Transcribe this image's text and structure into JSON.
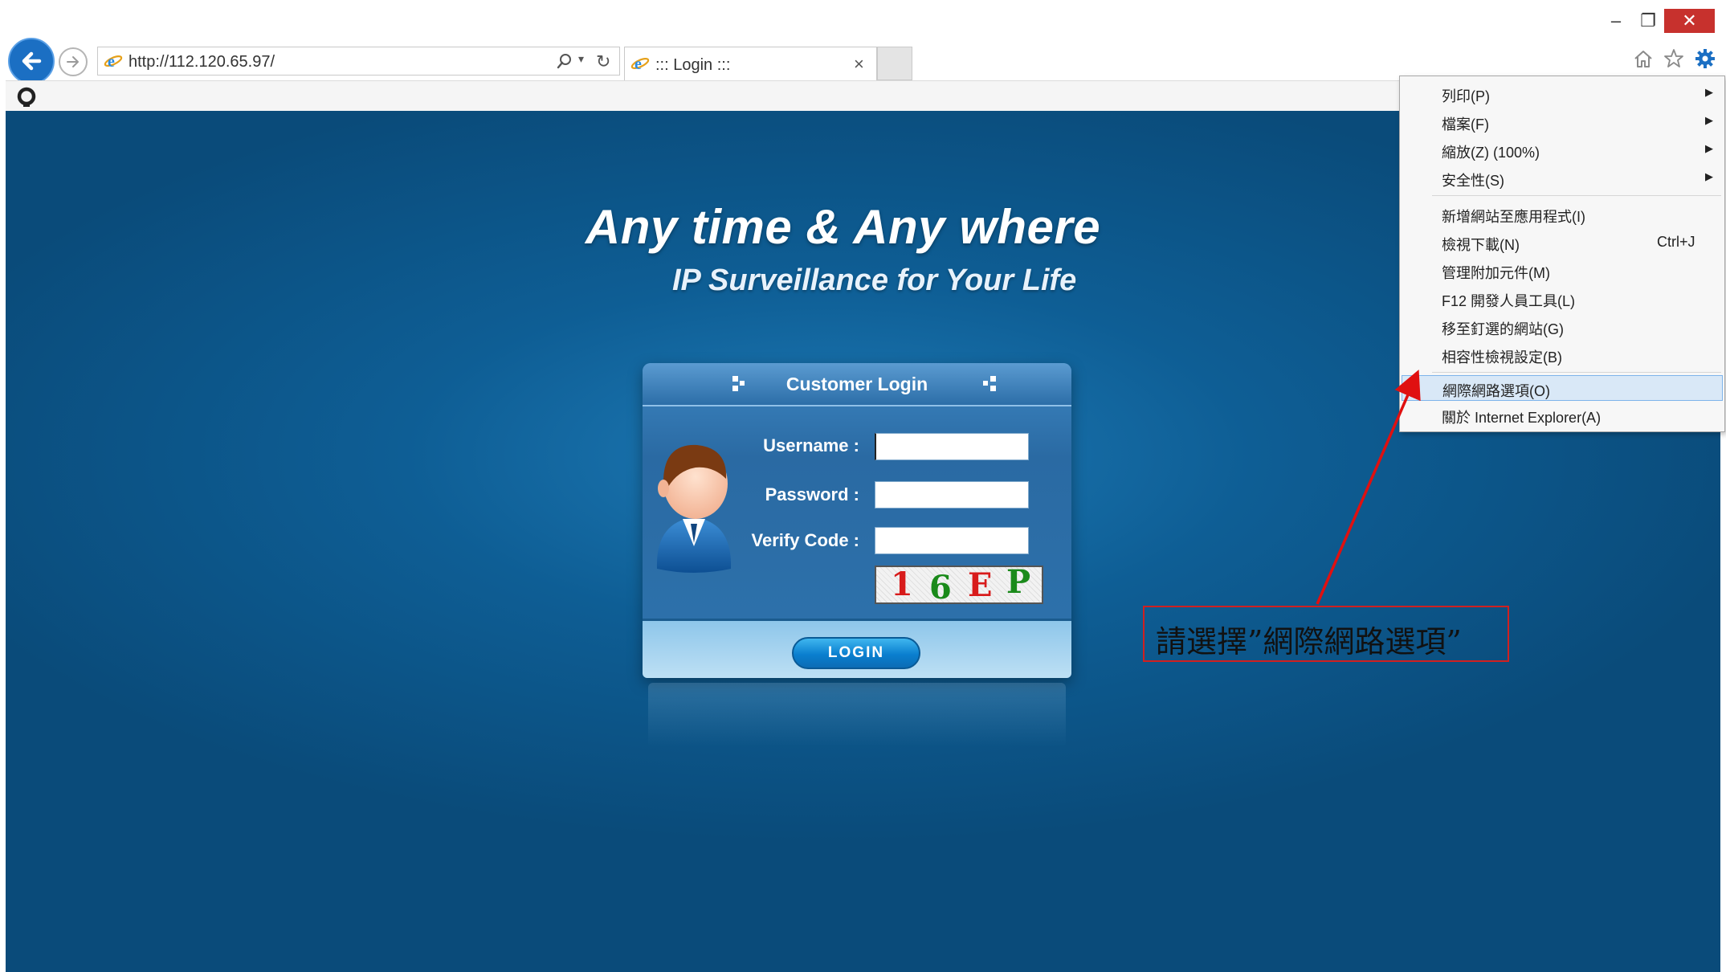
{
  "window": {
    "minimize_glyph": "–",
    "restore_glyph": "❐",
    "close_glyph": "✕"
  },
  "address_bar": {
    "url": "http://112.120.65.97/",
    "search_glyph": "⌕",
    "dropdown_glyph": "▾",
    "refresh_glyph": "↻"
  },
  "tab": {
    "title": "::: Login :::",
    "close_glyph": "×"
  },
  "page": {
    "headline": "Any time & Any where",
    "subheadline": "IP Surveillance for Your Life",
    "login": {
      "title": "Customer Login",
      "username_label": "Username :",
      "password_label": "Password :",
      "verify_label": "Verify Code :",
      "username_value": "",
      "password_value": "",
      "verify_value": "",
      "captcha_chars": [
        {
          "ch": "1",
          "color": "#d81b1b"
        },
        {
          "ch": "6",
          "color": "#1a8a1a"
        },
        {
          "ch": "E",
          "color": "#d81b1b"
        },
        {
          "ch": "P",
          "color": "#1a8a1a"
        }
      ],
      "login_button": "LOGIN"
    }
  },
  "tools_menu": {
    "items": [
      {
        "label": "列印(P)",
        "submenu": true
      },
      {
        "label": "檔案(F)",
        "submenu": true
      },
      {
        "label": "縮放(Z) (100%)",
        "submenu": true
      },
      {
        "label": "安全性(S)",
        "submenu": true
      },
      {
        "label": "新增網站至應用程式(I)",
        "submenu": false
      },
      {
        "label": "檢視下載(N)",
        "submenu": false,
        "shortcut": "Ctrl+J"
      },
      {
        "label": "管理附加元件(M)",
        "submenu": false
      },
      {
        "label": "F12 開發人員工具(L)",
        "submenu": false
      },
      {
        "label": "移至釘選的網站(G)",
        "submenu": false
      },
      {
        "label": "相容性檢視設定(B)",
        "submenu": false
      },
      {
        "label": "網際網路選項(O)",
        "submenu": false,
        "highlighted": true
      },
      {
        "label": "關於 Internet Explorer(A)",
        "submenu": false
      }
    ],
    "submenu_glyph": "▶"
  },
  "annotation": {
    "callout_text": "請選擇”網際網路選項”",
    "color": "#d02020"
  },
  "colors": {
    "accent": "#1b6fc3",
    "page_bg": "#0e5e95",
    "close_red": "#c7312d"
  }
}
